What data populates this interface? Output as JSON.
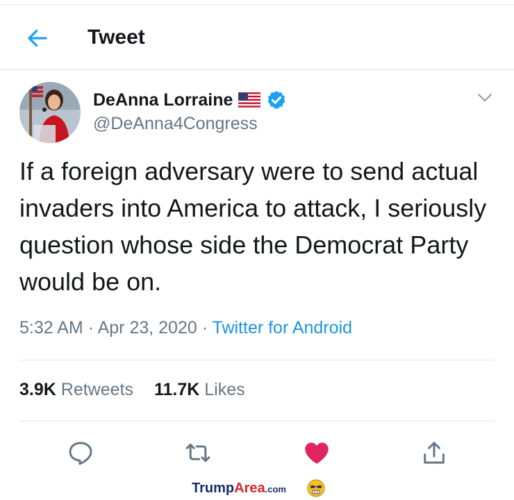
{
  "header": {
    "title": "Tweet",
    "back_icon": "arrow-left-icon"
  },
  "author": {
    "name": "DeAnna Lorraine",
    "handle": "@DeAnna4Congress",
    "flag_icon": "us-flag-icon",
    "verified_icon": "verified-badge-icon"
  },
  "tweet": {
    "text": "If a foreign adversary were to send actual invaders into America to attack, I seriously question whose side the Democrat Party would be on.",
    "time": "5:32 AM",
    "date": "Apr 23, 2020",
    "source": "Twitter for Android"
  },
  "stats": {
    "retweets_count": "3.9K",
    "retweets_label": "Retweets",
    "likes_count": "11.7K",
    "likes_label": "Likes"
  },
  "actions": [
    {
      "icon": "reply-icon"
    },
    {
      "icon": "retweet-icon"
    },
    {
      "icon": "like-heart-icon",
      "color": "#e0245e",
      "active": true
    },
    {
      "icon": "share-icon"
    }
  ],
  "colors": {
    "accent": "#1da1f2",
    "link": "#1b95e0",
    "secondary_text": "#657786",
    "like": "#e0245e"
  },
  "watermark": {
    "brand_part1": "Trump",
    "brand_part2": "Area",
    "domain": ".com"
  }
}
